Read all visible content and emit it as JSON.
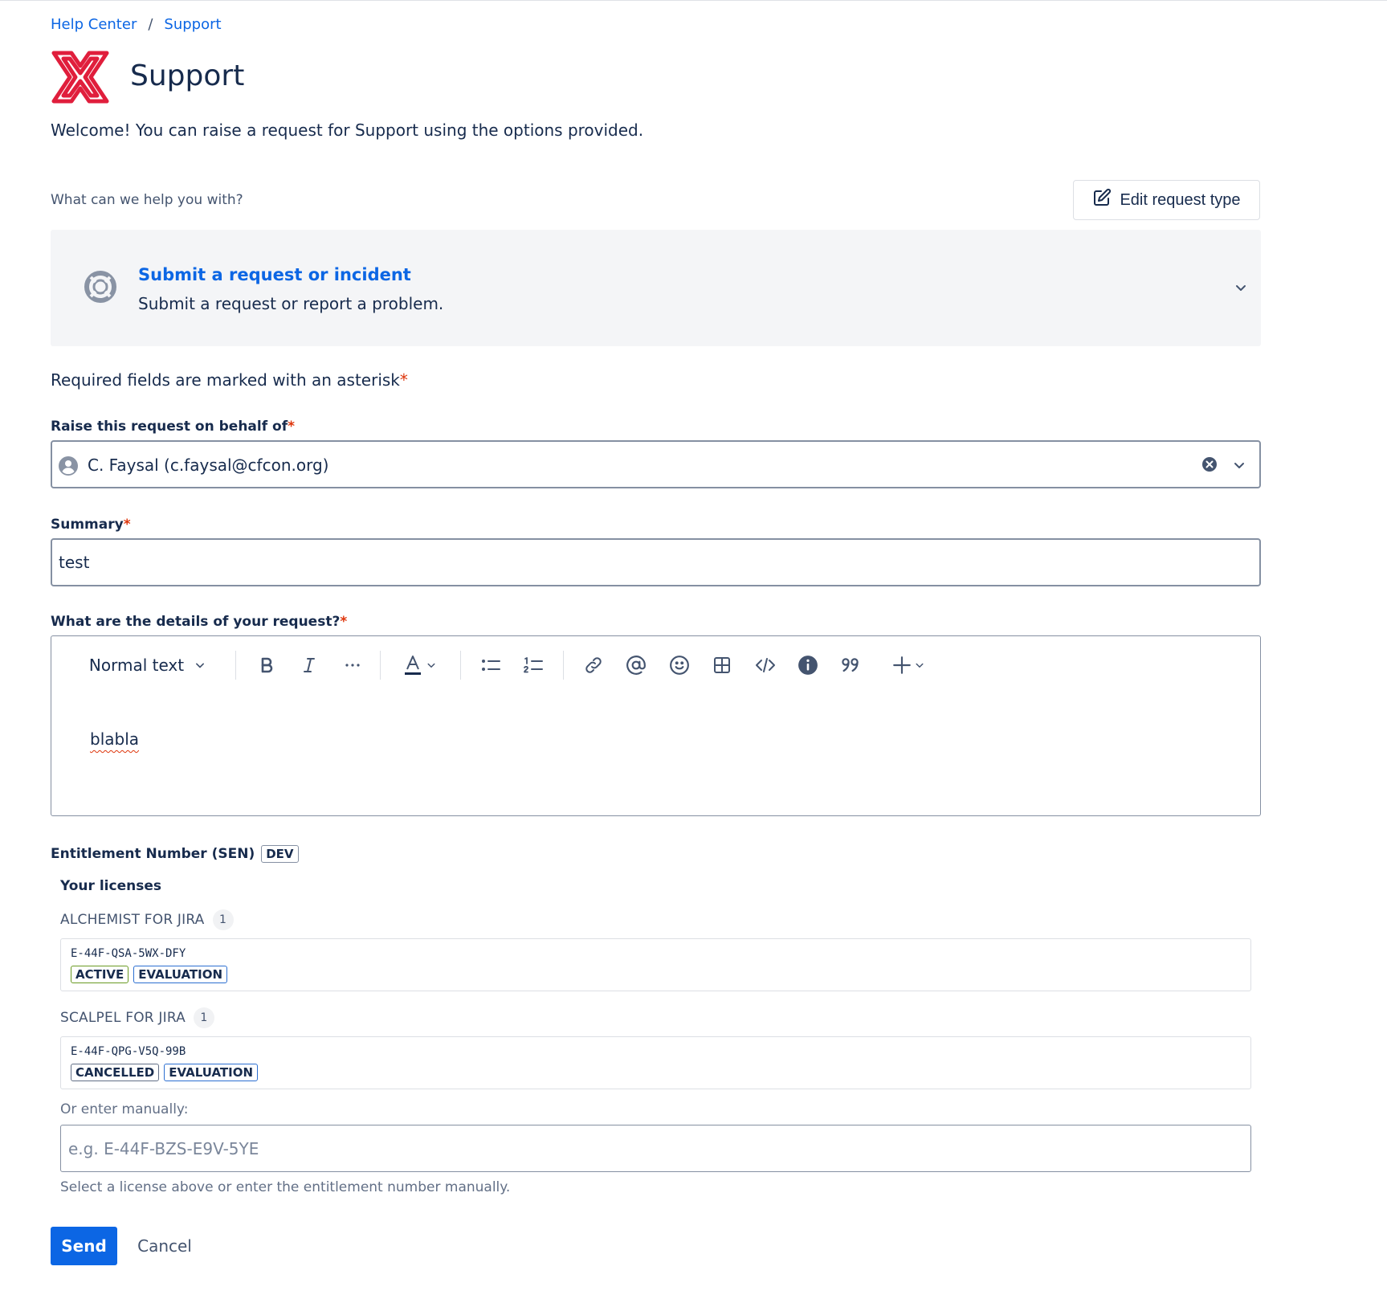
{
  "breadcrumb": {
    "home": "Help Center",
    "separator": "/",
    "current": "Support"
  },
  "header": {
    "title": "Support",
    "welcome": "Welcome! You can raise a request for Support using the options provided."
  },
  "request_type": {
    "prompt": "What can we help you with?",
    "edit_label": "Edit request type",
    "selected_title": "Submit a request or incident",
    "selected_description": "Submit a request or report a problem."
  },
  "form": {
    "required_note": "Required fields are marked with an asterisk",
    "asterisk": "*",
    "behalf_label": "Raise this request on behalf of",
    "behalf_value": "C. Faysal (c.faysal@cfcon.org)",
    "summary_label": "Summary",
    "summary_value": "test",
    "details_label": "What are the details of your request?",
    "editor": {
      "text_style": "Normal text",
      "body": "blabla",
      "toolbar_icons": [
        "bold-icon",
        "italic-icon",
        "more-icon",
        "text-color-icon",
        "bullet-list-icon",
        "numbered-list-icon",
        "link-icon",
        "mention-icon",
        "emoji-icon",
        "table-icon",
        "code-icon",
        "info-icon",
        "quote-icon",
        "insert-icon"
      ]
    }
  },
  "entitlement": {
    "label": "Entitlement Number (SEN)",
    "badge": "DEV",
    "licenses_title": "Your licenses",
    "products": [
      {
        "name": "ALCHEMIST FOR JIRA",
        "count": "1",
        "key": "E-44F-QSA-5WX-DFY",
        "status": "ACTIVE",
        "type": "EVALUATION"
      },
      {
        "name": "SCALPEL FOR JIRA",
        "count": "1",
        "key": "E-44F-QPG-V5Q-99B",
        "status": "CANCELLED",
        "type": "EVALUATION"
      }
    ],
    "manual_label": "Or enter manually:",
    "manual_placeholder": "e.g. E-44F-BZS-E9V-5YE",
    "helper": "Select a license above or enter the entitlement number manually."
  },
  "actions": {
    "send": "Send",
    "cancel": "Cancel"
  },
  "colors": {
    "link": "#0c66e4",
    "primary_button": "#0c66e4",
    "logo": "#e01e3c",
    "required": "#de350b",
    "active_lozenge": "#6a9a23",
    "evaluation_lozenge": "#2c6fd1",
    "cancelled_lozenge": "#626f86"
  }
}
